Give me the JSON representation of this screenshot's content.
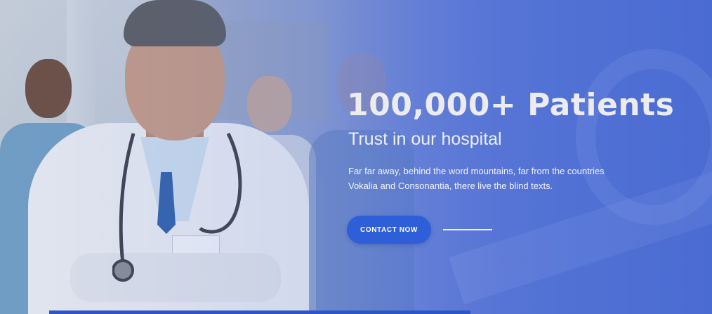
{
  "hero": {
    "title": "100,000+ Patients",
    "subtitle": "Trust in our hospital",
    "description_line1": "Far far away, behind the word mountains, far from the countries",
    "description_line2": "Vokalia and Consonantia, there live the blind texts.",
    "cta_label": "CONTACT NOW"
  },
  "colors": {
    "accent": "#2e5ed8",
    "overlay": "#4b6cd7",
    "text": "#ececee"
  },
  "icons": {
    "background_image": "doctor-photo"
  }
}
